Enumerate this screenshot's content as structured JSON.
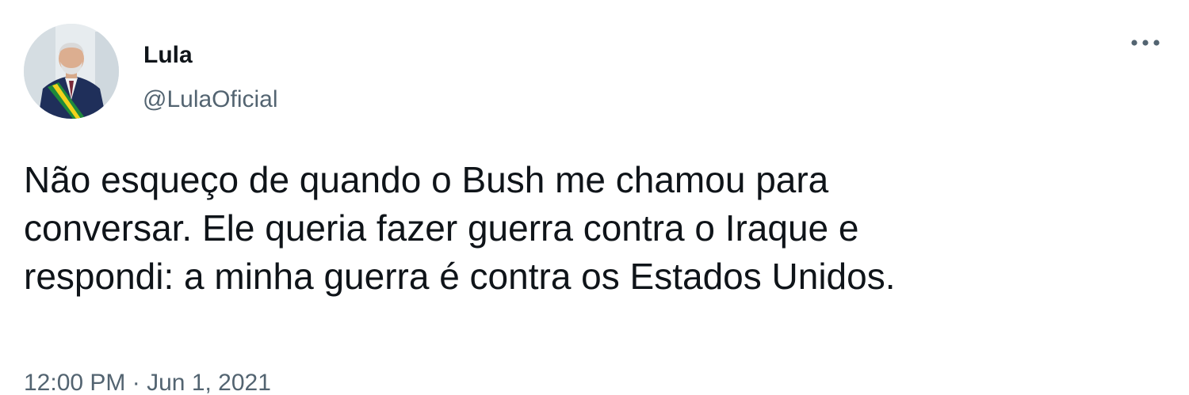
{
  "author": {
    "display_name": "Lula",
    "handle": "@LulaOficial",
    "avatar_icon": "profile-photo"
  },
  "tweet": {
    "lines": [
      "Não esqueço de quando o Bush me chamou para",
      "conversar. Ele queria fazer guerra contra o Iraque e",
      "respondi: a minha guerra é contra os Estados Unidos."
    ],
    "time": "12:00 PM",
    "separator": "·",
    "date": "Jun 1, 2021"
  },
  "controls": {
    "more_icon": "more-horizontal-icon"
  },
  "colors": {
    "text_primary": "#0f1419",
    "text_secondary": "#536471",
    "background": "#ffffff"
  }
}
